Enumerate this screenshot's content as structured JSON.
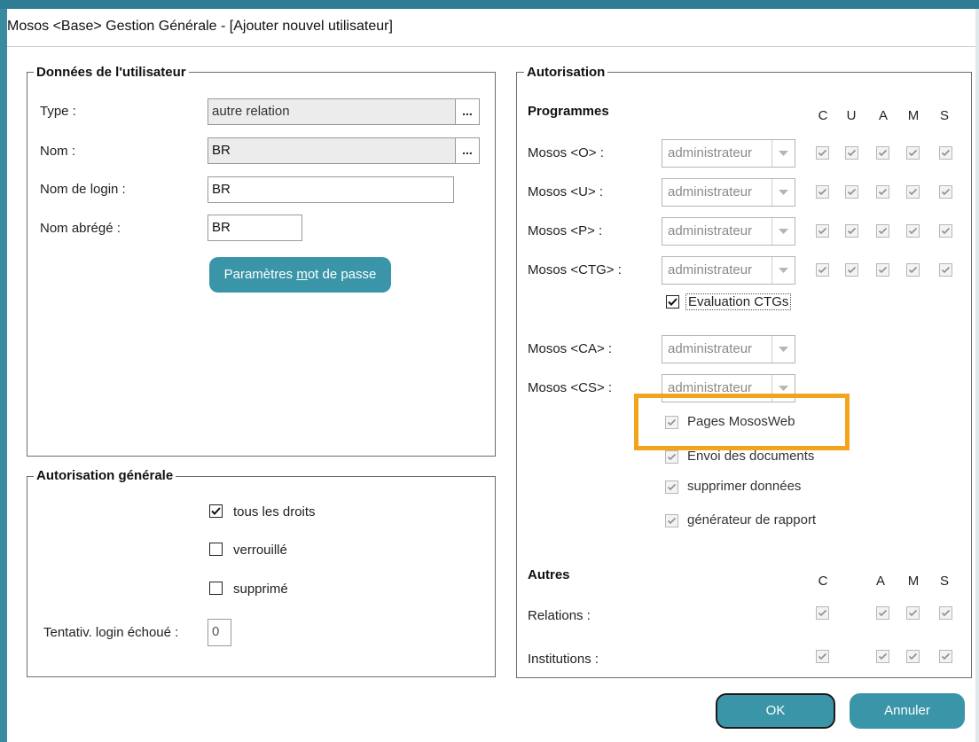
{
  "window": {
    "title": "Mosos <Base> Gestion Générale - [Ajouter nouvel utilisateur]"
  },
  "user_data": {
    "legend": "Données de l'utilisateur",
    "type_label": "Type :",
    "type_value": "autre relation",
    "type_button": "...",
    "nom_label": "Nom :",
    "nom_value": "BR",
    "nom_button": "...",
    "login_label": "Nom de login :",
    "login_value": "BR",
    "abbr_label": "Nom abrégé :",
    "abbr_value": "BR",
    "password_button_pre": "Paramètres ",
    "password_button_mnemonic": "m",
    "password_button_post": "ot de passe"
  },
  "general_auth": {
    "legend": "Autorisation générale",
    "all_rights_label": "tous les droits",
    "all_rights_checked": true,
    "locked_label": "verrouillé",
    "locked_checked": false,
    "deleted_label": "supprimé",
    "deleted_checked": false,
    "failed_login_label": "Tentativ. login échoué :",
    "failed_login_value": "0"
  },
  "authorization": {
    "legend": "Autorisation",
    "programs_heading": "Programmes",
    "perm_headers": [
      "C",
      "U",
      "A",
      "M",
      "S"
    ],
    "programs": [
      {
        "label": "Mosos <O> :",
        "role": "administrateur",
        "perms": [
          true,
          true,
          true,
          true,
          true
        ]
      },
      {
        "label": "Mosos <U> :",
        "role": "administrateur",
        "perms": [
          true,
          true,
          true,
          true,
          true
        ]
      },
      {
        "label": "Mosos <P> :",
        "role": "administrateur",
        "perms": [
          true,
          true,
          true,
          true,
          true
        ]
      },
      {
        "label": "Mosos <CTG> :",
        "role": "administrateur",
        "perms": [
          true,
          true,
          true,
          true,
          true
        ]
      },
      {
        "label": "Mosos <CA> :",
        "role": "administrateur"
      },
      {
        "label": "Mosos <CS> :",
        "role": "administrateur"
      }
    ],
    "ctg_eval_label": "Evaluation CTGs",
    "ctg_eval_checked": true,
    "extra_options": [
      {
        "label": "Pages MososWeb",
        "checked": true
      },
      {
        "label": "Envoi des documents",
        "checked": true
      },
      {
        "label": "supprimer données",
        "checked": true
      },
      {
        "label": "générateur de rapport",
        "checked": true
      }
    ],
    "others_heading": "Autres",
    "others_headers": [
      "C",
      "A",
      "M",
      "S"
    ],
    "others": [
      {
        "label": "Relations :",
        "perms": [
          true,
          true,
          true,
          true
        ]
      },
      {
        "label": "Institutions :",
        "perms": [
          true,
          true,
          true,
          true
        ]
      }
    ]
  },
  "highlight_color": "#f2a41c",
  "accent_color": "#3a95a8",
  "buttons": {
    "ok": "OK",
    "cancel": "Annuler"
  }
}
